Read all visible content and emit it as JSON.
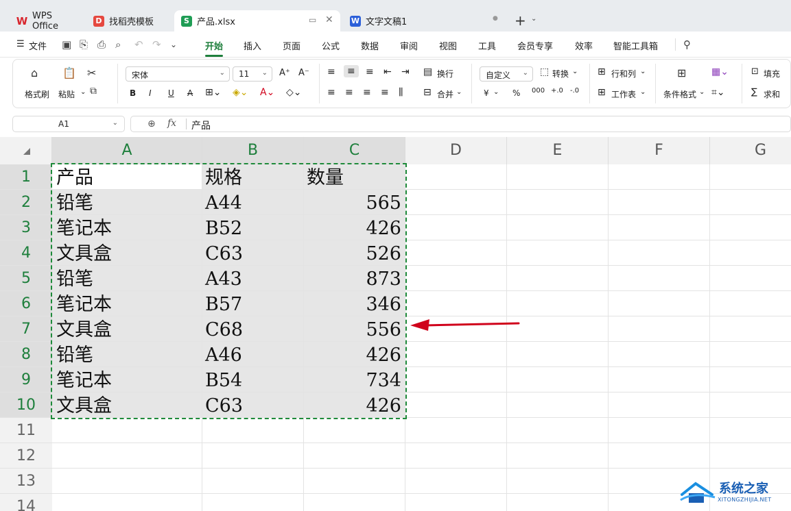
{
  "tabs": [
    {
      "label": "WPS Office",
      "logo": "W"
    },
    {
      "label": "找稻壳模板",
      "logo": "D"
    },
    {
      "label": "产品.xlsx",
      "logo": "S"
    },
    {
      "label": "文字文稿1",
      "logo": "W"
    }
  ],
  "menu": {
    "file": "文件",
    "items": [
      "开始",
      "插入",
      "页面",
      "公式",
      "数据",
      "审阅",
      "视图",
      "工具",
      "会员专享",
      "效率",
      "智能工具箱"
    ]
  },
  "ribbon": {
    "format_painter": "格式刷",
    "paste": "粘贴",
    "font_name": "宋体",
    "font_size": "11",
    "bold": "B",
    "italic": "I",
    "underline": "U",
    "strike": "A",
    "wrap": "换行",
    "merge": "合并",
    "number_format": "自定义",
    "convert": "转换",
    "currency": "¥",
    "percent": "%",
    "thousands": "000",
    "dec_inc": "+.0",
    "dec_dec": "-.0",
    "rows_cols": "行和列",
    "worksheet": "工作表",
    "cond_format": "条件格式",
    "fill": "填充",
    "sum": "求和"
  },
  "formula_bar": {
    "cell_ref": "A1",
    "fx": "fx",
    "content": "产品"
  },
  "sheet": {
    "columns": [
      "A",
      "B",
      "C",
      "D",
      "E",
      "F",
      "G"
    ],
    "rows": [
      "1",
      "2",
      "3",
      "4",
      "5",
      "6",
      "7",
      "8",
      "9",
      "10",
      "11",
      "12",
      "13",
      "14"
    ],
    "cells": [
      [
        "产品",
        "规格",
        "数量"
      ],
      [
        "铅笔",
        "A44",
        "565"
      ],
      [
        "笔记本",
        "B52",
        "426"
      ],
      [
        "文具盒",
        "C63",
        "526"
      ],
      [
        "铅笔",
        "A43",
        "873"
      ],
      [
        "笔记本",
        "B57",
        "346"
      ],
      [
        "文具盒",
        "C68",
        "556"
      ],
      [
        "铅笔",
        "A46",
        "426"
      ],
      [
        "笔记本",
        "B54",
        "734"
      ],
      [
        "文具盒",
        "C63",
        "426"
      ]
    ]
  },
  "watermark": {
    "title": "系统之家",
    "subtitle": "XITONGZHIJIA.NET"
  },
  "colors": {
    "accent_green": "#1e7f3c",
    "arrow_red": "#d0021b",
    "watermark_blue": "#1a5fb4"
  }
}
